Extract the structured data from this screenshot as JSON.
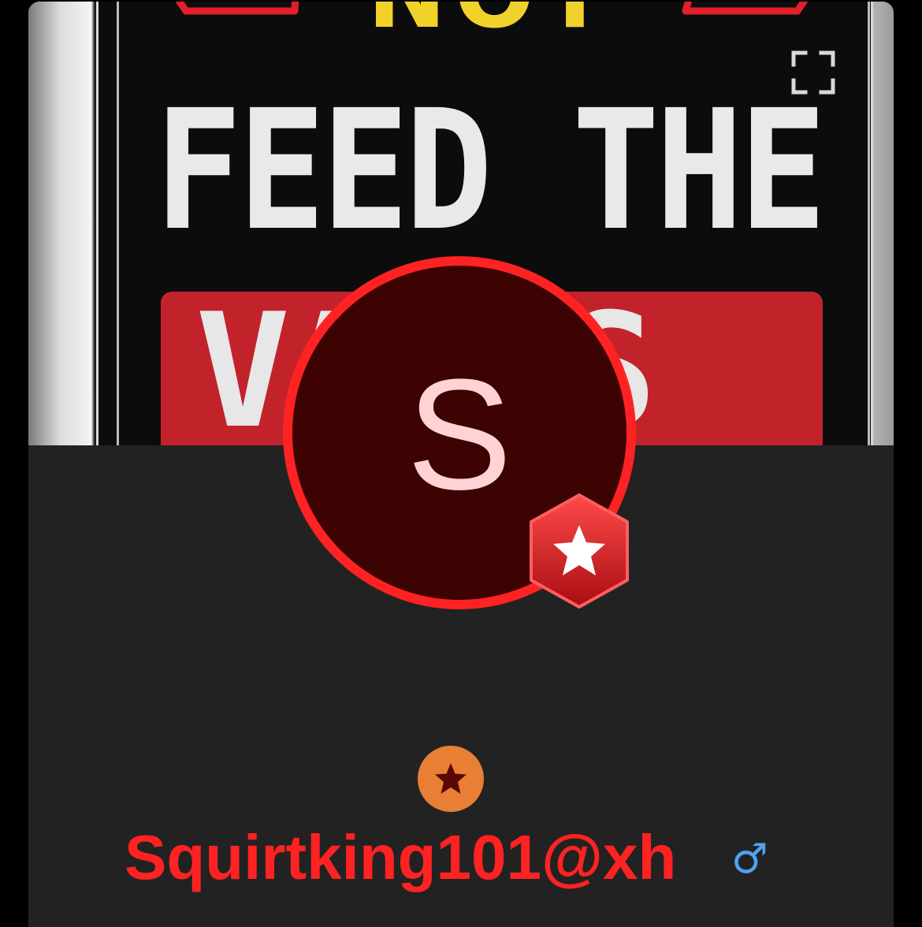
{
  "cover": {
    "sign_top_text": "NOT",
    "sign_middle_text": "FEED THE",
    "sign_bottom_text": "VAPES"
  },
  "avatar": {
    "initial": "S"
  },
  "profile": {
    "username": "Squirtking101@xh",
    "gender_symbol": "♂"
  },
  "colors": {
    "accent": "#ff2222",
    "avatar_bg": "#3d0303",
    "panel_bg": "#222222",
    "level_badge": "#e87f35",
    "gender": "#4ea3f0"
  },
  "icons": {
    "expand": "fullscreen-icon",
    "verified": "star-hexagon-icon",
    "level": "star-circle-icon"
  }
}
